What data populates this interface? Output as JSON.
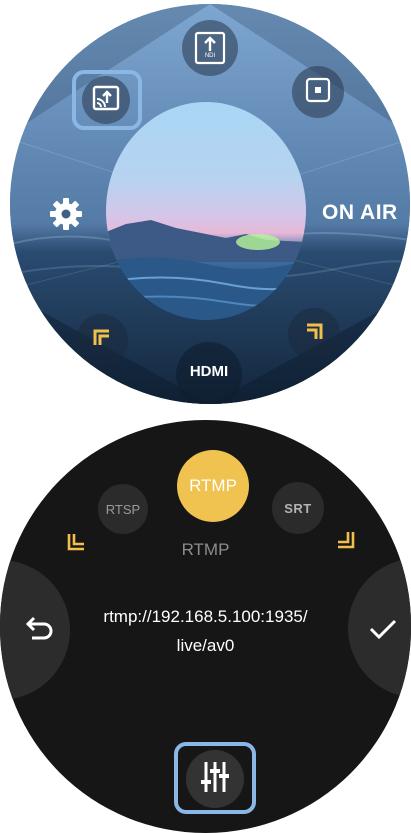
{
  "top_dial": {
    "on_air_label": "ON AIR",
    "hdmi_label": "HDMI",
    "ndi_label": "NDI",
    "icons": [
      "cast-icon",
      "ndi-upload-icon",
      "stop-icon",
      "gear-icon",
      "corner-top-left-icon",
      "corner-top-right-icon"
    ],
    "accent_color": "#8ab7e6",
    "corner_color": "#f2c04a"
  },
  "bottom_dial": {
    "protocols": [
      "RTSP",
      "RTMP",
      "SRT"
    ],
    "selected_protocol": "RTMP",
    "mode_label": "RTMP",
    "url_line1": "rtmp://192.168.5.100:1935/",
    "url_line2": "live/av0",
    "icons": [
      "back-icon",
      "check-icon",
      "sliders-icon",
      "corner-bottom-left-icon",
      "corner-bottom-right-icon"
    ],
    "selected_color": "#f0c24f"
  }
}
